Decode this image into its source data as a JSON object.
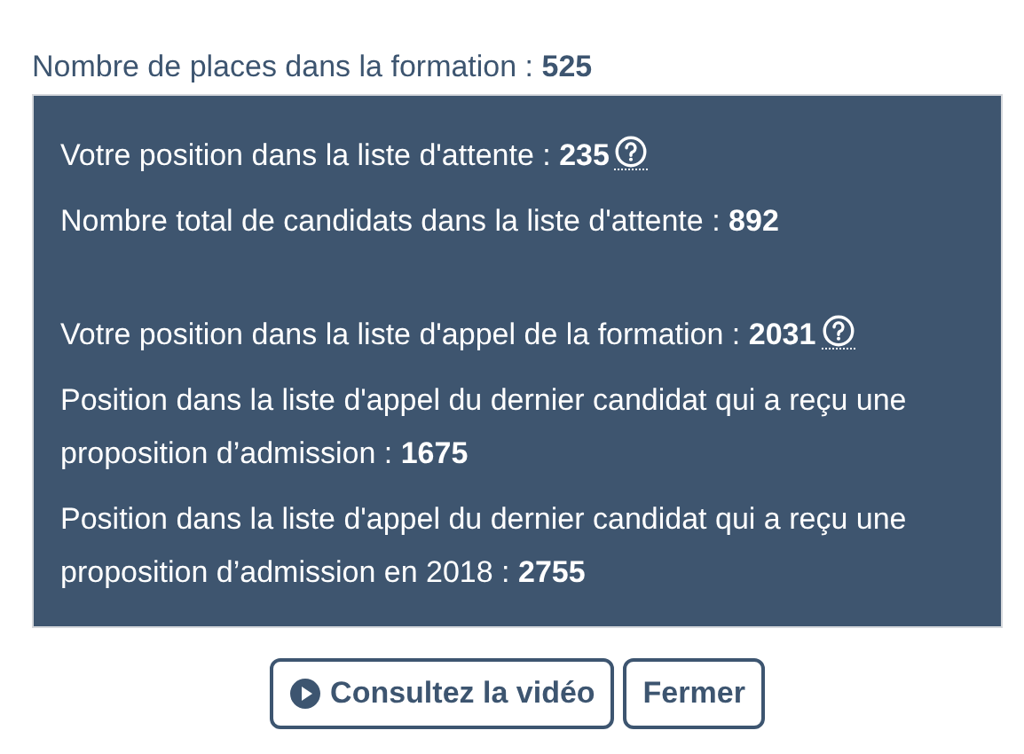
{
  "places": {
    "label": "Nombre de places dans la formation : ",
    "value": "525"
  },
  "groups": [
    {
      "lines": [
        {
          "text": "Votre position dans la liste d'attente : **235**",
          "help_icon": true
        },
        {
          "text": "Nombre total de candidats dans la liste d'attente : **892**",
          "help_icon": false
        }
      ]
    },
    {
      "lines": [
        {
          "text": "Votre position dans la liste d'appel de la formation : **2031**",
          "help_icon": true
        },
        {
          "text": "Position dans la liste d'appel du dernier candidat qui a reçu une proposition d’admission : **1675**",
          "help_icon": false
        },
        {
          "text": "Position dans la liste d'appel du dernier candidat qui a reçu une proposition d’admission en 2018 : **2755**",
          "help_icon": false
        }
      ]
    }
  ],
  "buttons": [
    {
      "label": "Consultez la vidéo",
      "kind": "video"
    },
    {
      "label": "Fermer",
      "kind": "close"
    }
  ]
}
